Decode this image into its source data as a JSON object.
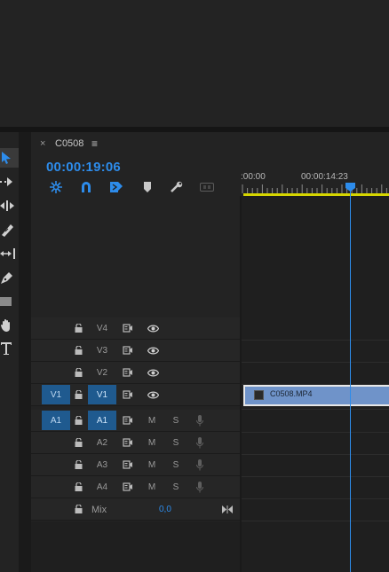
{
  "sequence_tab": {
    "close_glyph": "×",
    "title": "C0508",
    "menu_glyph": "≡"
  },
  "timecode": "00:00:19:06",
  "ruler": {
    "labels": [
      ":00:00",
      "00:00:14:23"
    ]
  },
  "tools": [
    "selection-tool",
    "track-select-tool",
    "ripple-edit-tool",
    "razor-tool",
    "slip-tool",
    "pen-tool",
    "rectangle-tool",
    "hand-tool",
    "type-tool"
  ],
  "toolbar_icons": [
    "snap-icon",
    "linked-selection-icon",
    "add-marker-icon",
    "marker-icon",
    "settings-wrench-icon",
    "captions-icon"
  ],
  "video_tracks": [
    {
      "name": "V4",
      "source": ""
    },
    {
      "name": "V3",
      "source": ""
    },
    {
      "name": "V2",
      "source": ""
    },
    {
      "name": "V1",
      "source": "V1"
    }
  ],
  "audio_tracks": [
    {
      "name": "A1",
      "source": "A1",
      "mute": "M",
      "solo": "S"
    },
    {
      "name": "A2",
      "source": "",
      "mute": "M",
      "solo": "S"
    },
    {
      "name": "A3",
      "source": "",
      "mute": "M",
      "solo": "S"
    },
    {
      "name": "A4",
      "source": "",
      "mute": "M",
      "solo": "S"
    }
  ],
  "mix": {
    "label": "Mix",
    "value": "0,0"
  },
  "clip": {
    "name": "C0508.MP4"
  },
  "colors": {
    "accent_blue": "#2d8ceb",
    "work_area": "#d6d600",
    "clip_fill": "#6f93c9",
    "panel_bg": "#232323"
  }
}
